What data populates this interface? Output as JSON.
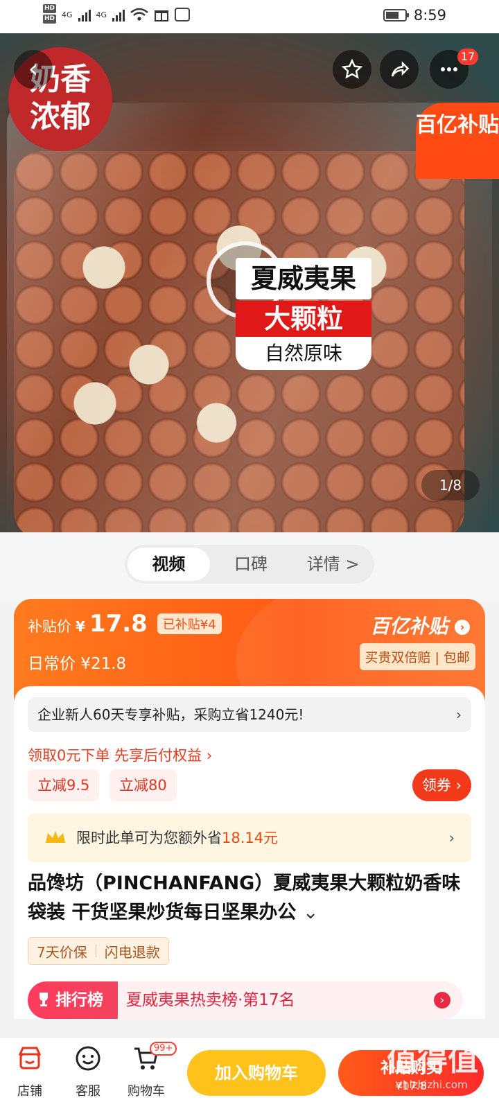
{
  "status_bar": {
    "hd1": "HD",
    "hd2": "HD",
    "net1": "4G",
    "net2": "4G",
    "time": "8:59"
  },
  "hero": {
    "badge_line1": "奶香",
    "badge_line2": "浓郁",
    "subsidy_corner": "百亿补贴",
    "overlay_title": "夏威夷果",
    "overlay_big": "大颗粒",
    "overlay_natural": "自然原味",
    "pager": "1/8",
    "message_count": "17"
  },
  "media_tabs": [
    "视频",
    "口碑",
    "详情 >"
  ],
  "price": {
    "subsidy_label": "补贴价",
    "currency": "¥",
    "subsidy_amount": "17.8",
    "subsidized_tag": "已补贴¥4",
    "regular_label": "日常价 ¥21.8",
    "brand": "百亿补贴",
    "guarantee": "买贵双倍赔 | 包邮"
  },
  "promo": {
    "enterprise_banner": "企业新人60天专享补贴，采购立省1240元!",
    "pay_later": "领取0元下单 先享后付权益 ›",
    "coupon1": "立减9.5",
    "coupon2": "立减80",
    "get_coupon": "领券",
    "extra_save_prefix": "限时此单可为您额外省",
    "extra_save_amount": "18.14元"
  },
  "product": {
    "title": "品馋坊（PINCHANFANG）夏威夷果大颗粒奶香味袋装 干货坚果炒货每日坚果办公",
    "tag1": "7天价保",
    "tag2": "闪电退款",
    "rank_label": "排行榜",
    "rank_text": "夏威夷果热卖榜·第17名"
  },
  "bottom_bar": {
    "shop": "店铺",
    "service": "客服",
    "cart": "购物车",
    "cart_badge": "99+",
    "add_to_cart": "加入购物车",
    "buy_line1": "补贴购买",
    "buy_line2": "¥17.8"
  },
  "watermark": {
    "main": "值得值",
    "sub": "zhizhizhi.com"
  },
  "colors": {
    "accent_orange": "#ff5a14",
    "accent_red": "#f23a1a",
    "cart_yellow": "#ffc21a"
  }
}
